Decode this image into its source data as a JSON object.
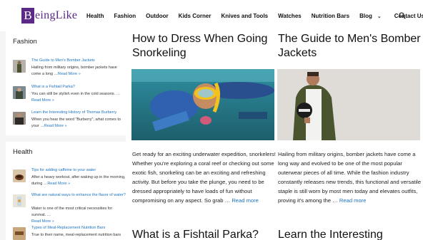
{
  "brand": {
    "letter": "B",
    "rest": "eingLike"
  },
  "nav": {
    "items": [
      "Health",
      "Fashion",
      "Outdoor",
      "Kids Corner",
      "Knives and Tools",
      "Watches",
      "Nutrition Bars",
      "Blog",
      "Contact Us"
    ]
  },
  "sidebar": {
    "fashion": {
      "title": "Fashion",
      "posts": [
        {
          "title": "The Guide to Men's Bomber Jackets",
          "text": "Hailing from military origins, bomber jackets have come a long …",
          "more": "Read More »"
        },
        {
          "title": "What is a Fishtail Parka?",
          "text": "You can still be stylish even in the cold seasons. …",
          "more": "Read More »"
        },
        {
          "title": "Learn the Interesting History of Thomas Burberry",
          "text": "When you hear the word \"Burberry\", what comes to your …",
          "more": "Read More »"
        }
      ]
    },
    "health": {
      "title": "Health",
      "posts": [
        {
          "title": "Tips for adding caffeine to your water",
          "text": "After a heavy workout, after waking up in the morning, during …",
          "more": "Read More »"
        },
        {
          "title": "What are natural ways to enhance the flavor of water?",
          "text": "Water is one of the most critical necessities for survival. …",
          "more": "Read More »"
        },
        {
          "title": "Types of Meal-Replacement Nutrition Bars",
          "text": "True to their name, meal-replacement nutrition bars",
          "more": ""
        }
      ]
    }
  },
  "articles": [
    {
      "title": "How to Dress When Going Snorkeling",
      "excerpt": "Get ready for an exciting underwater expedition, snorkelers! Whether you're exploring a coral reef or checking out some exotic fish, snorkeling can be an exciting and refreshing activity. But before you take the plunge, you need to be dressed appropriately to have loads of fun without compromising on any aspect. So grab …",
      "more": "Read more"
    },
    {
      "title": "The Guide to Men's Bomber Jackets",
      "excerpt": "Hailing from military origins, bomber jackets have come a long way and evolved to be one of the most popular outerwear pieces of all time. While the fashion industry constantly releases new trends, this functional and versatile staple is still worn by most men today and elevates outfits, proving it's among the …",
      "more": "Read more"
    },
    {
      "title": "What is a Fishtail Parka?"
    },
    {
      "title": "Learn the Interesting"
    }
  ],
  "icons": {
    "search": "search-icon",
    "chevron": "chevron-down-icon"
  },
  "colors": {
    "brand": "#5a2a86",
    "link": "#1e73be",
    "sidebar_bg": "#f5f5f5"
  }
}
